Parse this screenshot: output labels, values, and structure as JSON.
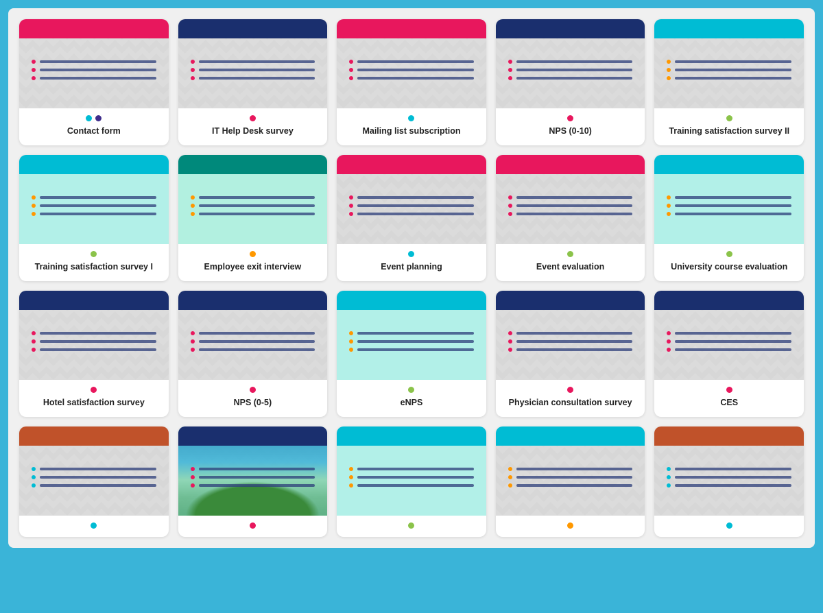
{
  "cards": [
    {
      "id": "contact-form",
      "label": "Contact form",
      "headerColor": "#e8175d",
      "contentBg": null,
      "dotColors": [
        "#00bcd4",
        "#3f2d8c"
      ],
      "barColor": "#2c3e7a",
      "lineCount": 3
    },
    {
      "id": "it-help-desk",
      "label": "IT Help Desk survey",
      "headerColor": "#1a2f6e",
      "contentBg": null,
      "dotColors": [
        "#e8175d"
      ],
      "barColor": "#2c3e7a",
      "lineCount": 3
    },
    {
      "id": "mailing-list",
      "label": "Mailing list subscription",
      "headerColor": "#e8175d",
      "contentBg": null,
      "dotColors": [
        "#00bcd4"
      ],
      "barColor": "#2c3e7a",
      "lineCount": 3
    },
    {
      "id": "nps-0-10",
      "label": "NPS (0-10)",
      "headerColor": "#1a2f6e",
      "contentBg": null,
      "dotColors": [
        "#e8175d"
      ],
      "barColor": "#2c3e7a",
      "lineCount": 3
    },
    {
      "id": "training-sat-2",
      "label": "Training satisfaction survey II",
      "headerColor": "#00bcd4",
      "contentBg": null,
      "dotColors": [
        "#8bc34a"
      ],
      "barColor": "#2c3e7a",
      "lineCount": 3
    },
    {
      "id": "training-sat-1",
      "label": "Training satisfaction survey I",
      "headerColor": "#00bcd4",
      "contentBg": "#b2f0e8",
      "dotColors": [
        "#8bc34a"
      ],
      "barColor": "#2c3e7a",
      "dotLineColors": [
        "#ff9800",
        "#ff9800",
        "#ff9800"
      ],
      "lineCount": 3
    },
    {
      "id": "employee-exit",
      "label": "Employee exit interview",
      "headerColor": "#00897b",
      "contentBg": "#b2f0e0",
      "dotColors": [
        "#ff9800"
      ],
      "barColor": "#2c3e7a",
      "dotLineColors": [
        "#ff9800",
        "#ff9800",
        "#ff9800"
      ],
      "lineCount": 3
    },
    {
      "id": "event-planning",
      "label": "Event planning",
      "headerColor": "#e8175d",
      "contentBg": null,
      "dotColors": [
        "#00bcd4"
      ],
      "barColor": "#2c3e7a",
      "dotLineColors": [
        "#e8175d",
        "#e8175d",
        "#e8175d"
      ],
      "lineCount": 3
    },
    {
      "id": "event-evaluation",
      "label": "Event evaluation",
      "headerColor": "#e8175d",
      "contentBg": null,
      "dotColors": [
        "#8bc34a"
      ],
      "barColor": "#2c3e7a",
      "dotLineColors": [
        "#e8175d",
        "#e8175d",
        "#e8175d"
      ],
      "lineCount": 3
    },
    {
      "id": "university-course",
      "label": "University course evaluation",
      "headerColor": "#00bcd4",
      "contentBg": "#b2f0e8",
      "dotColors": [
        "#8bc34a"
      ],
      "barColor": "#2c3e7a",
      "dotLineColors": [
        "#ff9800",
        "#ff9800",
        "#ff9800"
      ],
      "lineCount": 3
    },
    {
      "id": "hotel-sat",
      "label": "Hotel satisfaction survey",
      "headerColor": "#1a2f6e",
      "contentBg": null,
      "dotColors": [
        "#e8175d"
      ],
      "barColor": "#2c3e7a",
      "dotLineColors": [
        "#e8175d",
        "#e8175d",
        "#e8175d"
      ],
      "lineCount": 3
    },
    {
      "id": "nps-0-5",
      "label": "NPS (0-5)",
      "headerColor": "#1a2f6e",
      "contentBg": null,
      "dotColors": [
        "#e8175d"
      ],
      "barColor": "#2c3e7a",
      "dotLineColors": [
        "#e8175d",
        "#e8175d",
        "#e8175d"
      ],
      "lineCount": 3
    },
    {
      "id": "enps",
      "label": "eNPS",
      "headerColor": "#00bcd4",
      "contentBg": "#b2f0e8",
      "dotColors": [
        "#8bc34a"
      ],
      "barColor": "#2c3e7a",
      "dotLineColors": [
        "#ff9800",
        "#ff9800",
        "#ff9800"
      ],
      "lineCount": 3
    },
    {
      "id": "physician-consult",
      "label": "Physician consultation survey",
      "headerColor": "#1a2f6e",
      "contentBg": null,
      "dotColors": [
        "#e8175d"
      ],
      "barColor": "#2c3e7a",
      "dotLineColors": [
        "#e8175d",
        "#e8175d",
        "#e8175d"
      ],
      "lineCount": 3
    },
    {
      "id": "ces",
      "label": "CES",
      "headerColor": "#1a2f6e",
      "contentBg": null,
      "dotColors": [
        "#e8175d"
      ],
      "barColor": "#2c3e7a",
      "dotLineColors": [
        "#e8175d",
        "#e8175d",
        "#e8175d"
      ],
      "lineCount": 3
    },
    {
      "id": "row4-1",
      "label": "",
      "headerColor": "#c0522a",
      "contentBg": null,
      "dotColors": [
        "#00bcd4"
      ],
      "barColor": "#2c3e7a",
      "dotLineColors": [
        "#00bcd4",
        "#00bcd4",
        "#00bcd4"
      ],
      "lineCount": 3
    },
    {
      "id": "row4-2",
      "label": "",
      "headerColor": "#1a2f6e",
      "contentBg": "photo",
      "dotColors": [
        "#e8175d"
      ],
      "barColor": "#2c3e7a",
      "dotLineColors": [
        "#e8175d",
        "#e8175d",
        "#e8175d"
      ],
      "lineCount": 3
    },
    {
      "id": "row4-3",
      "label": "",
      "headerColor": "#00bcd4",
      "contentBg": "#b2f0e8",
      "dotColors": [
        "#8bc34a"
      ],
      "barColor": "#2c3e7a",
      "dotLineColors": [
        "#ff9800",
        "#ff9800",
        "#ff9800"
      ],
      "lineCount": 3
    },
    {
      "id": "row4-4",
      "label": "",
      "headerColor": "#00bcd4",
      "contentBg": null,
      "dotColors": [
        "#ff9800"
      ],
      "barColor": "#2c3e7a",
      "dotLineColors": [
        "#ff9800",
        "#ff9800",
        "#ff9800"
      ],
      "lineCount": 3
    },
    {
      "id": "row4-5",
      "label": "",
      "headerColor": "#c0522a",
      "contentBg": null,
      "dotColors": [
        "#00bcd4"
      ],
      "barColor": "#2c3e7a",
      "dotLineColors": [
        "#00bcd4",
        "#00bcd4",
        "#00bcd4"
      ],
      "lineCount": 3
    }
  ]
}
